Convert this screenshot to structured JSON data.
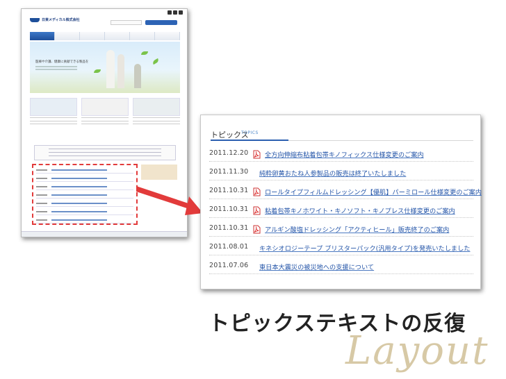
{
  "thumbnail": {
    "site_name": "日東メディカル株式会社",
    "hero_copy": "医療や介護、健康に貢献できる製品を"
  },
  "topics": {
    "title": "トピックス",
    "title_en": "TOPICS",
    "items": [
      {
        "date": "2011.12.20",
        "text": "全方向伸縮布粘着包帯キノフィックス仕様変更のご案内",
        "pdf": true
      },
      {
        "date": "2011.11.30",
        "text": "純粋卵黄おたね人参製品の販売は終了いたしました",
        "pdf": false
      },
      {
        "date": "2011.10.31",
        "text": "ロールタイプフィルムドレッシング【優肌】パーミロール仕様変更のご案内",
        "pdf": true
      },
      {
        "date": "2011.10.31",
        "text": "粘着包帯キノホワイト・キノソフト・キノプレス仕様変更のご案内",
        "pdf": true
      },
      {
        "date": "2011.10.31",
        "text": "アルギン酸塩ドレッシング「アクティヒール」販売終了のご案内",
        "pdf": true
      },
      {
        "date": "2011.08.01",
        "text": "キネシオロジーテープ ブリスターパック(汎用タイプ)を発売いたしました",
        "pdf": false
      },
      {
        "date": "2011.07.06",
        "text": "東日本大震災の被災地への支援について",
        "pdf": false
      }
    ]
  },
  "caption": "トピックステキストの反復",
  "watermark": "Layout",
  "colors": {
    "link": "#2455a8",
    "highlight": "#e23b3b",
    "accent_rule": "#2b5fb0",
    "watermark": "#d7c9a6"
  }
}
